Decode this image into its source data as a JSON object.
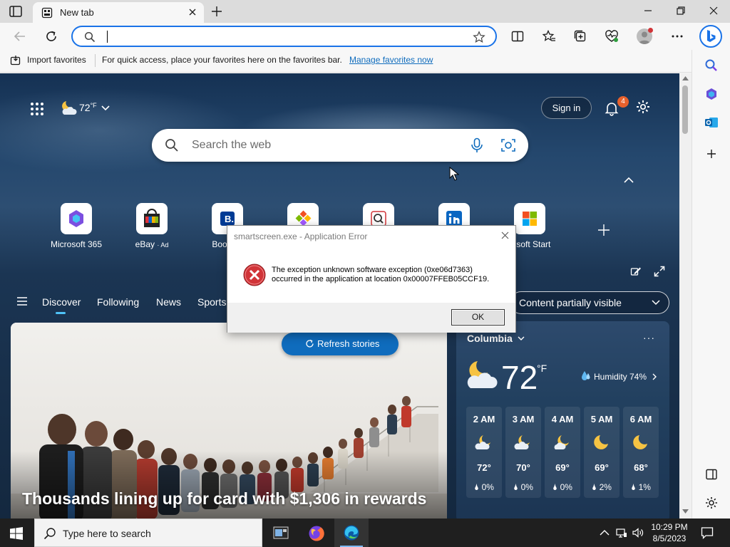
{
  "browser": {
    "tab_title": "New tab",
    "omnibox_value": "",
    "favorites": {
      "import_label": "Import favorites",
      "message": "For quick access, place your favorites here on the favorites bar.",
      "manage_link": "Manage favorites now"
    }
  },
  "newtab": {
    "weather_temp": "72",
    "weather_unit": "°F",
    "signin_label": "Sign in",
    "notification_count": "4",
    "search_placeholder": "Search the web",
    "tiles": [
      {
        "label": "Microsoft 365",
        "sub": ""
      },
      {
        "label": "eBay",
        "sub": "· Ad"
      },
      {
        "label": "Booking",
        "sub": ""
      },
      {
        "label": "",
        "sub": ""
      },
      {
        "label": "",
        "sub": ""
      },
      {
        "label": "",
        "sub": ""
      },
      {
        "label": "rosoft Start",
        "sub": ""
      }
    ],
    "feed_tabs": [
      "Discover",
      "Following",
      "News",
      "Sports"
    ],
    "content_visibility": "Content partially visible",
    "refresh_label": "Refresh stories",
    "hero_headline": "Thousands lining up for card with $1,306 in rewards"
  },
  "weather_card": {
    "city": "Columbia",
    "temp": "72",
    "unit": "°F",
    "humidity": "Humidity 74%",
    "hours": [
      {
        "time": "2 AM",
        "temp": "72°",
        "precip": "0%",
        "icon": "moon-cloud-icon"
      },
      {
        "time": "3 AM",
        "temp": "70°",
        "precip": "0%",
        "icon": "moon-cloud-icon"
      },
      {
        "time": "4 AM",
        "temp": "69°",
        "precip": "0%",
        "icon": "moon-cloud-icon"
      },
      {
        "time": "5 AM",
        "temp": "69°",
        "precip": "2%",
        "icon": "moon-icon"
      },
      {
        "time": "6 AM",
        "temp": "68°",
        "precip": "1%",
        "icon": "moon-icon"
      }
    ]
  },
  "dialog": {
    "title": "smartscreen.exe - Application Error",
    "line1": "The exception unknown software exception (0xe06d7363)",
    "line2": "occurred in the application at location 0x00007FFEB05CCF19.",
    "ok_label": "OK"
  },
  "taskbar": {
    "search_placeholder": "Type here to search",
    "time": "10:29 PM",
    "date": "8/5/2023"
  },
  "colors": {
    "accent": "#0f6cbd",
    "error_red": "#d13438",
    "badge_orange": "#e8612c"
  }
}
